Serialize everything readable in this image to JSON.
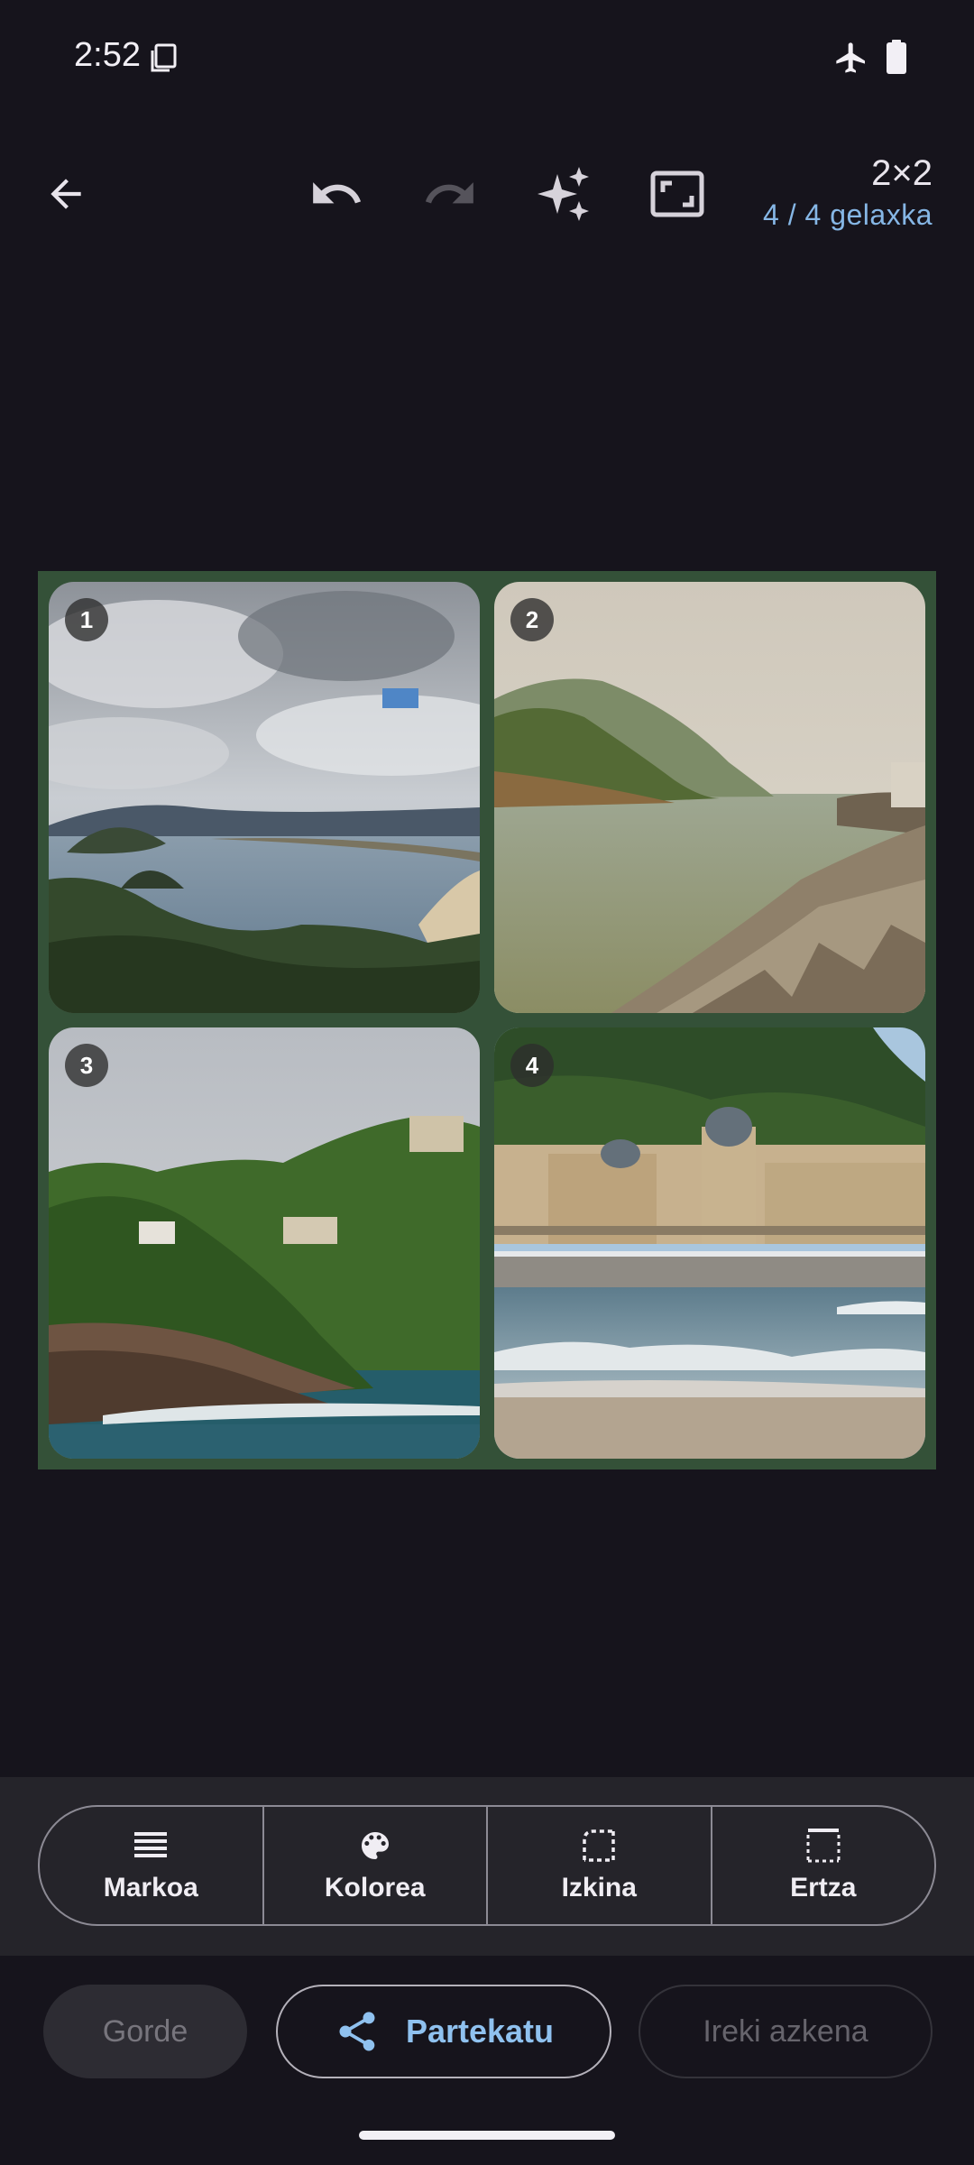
{
  "status": {
    "time": "2:52"
  },
  "toolbar": {
    "grid_size": "2×2",
    "cell_count": "4 / 4 gelaxka"
  },
  "collage": {
    "cells": [
      {
        "number": "1"
      },
      {
        "number": "2"
      },
      {
        "number": "3"
      },
      {
        "number": "4"
      }
    ],
    "border_color": "#345138"
  },
  "tools": [
    {
      "label": "Markoa",
      "icon": "frame-lines-icon"
    },
    {
      "label": "Kolorea",
      "icon": "palette-icon"
    },
    {
      "label": "Izkina",
      "icon": "corner-icon"
    },
    {
      "label": "Ertza",
      "icon": "border-icon"
    }
  ],
  "actions": {
    "save": "Gorde",
    "share": "Partekatu",
    "open_last": "Ireki azkena"
  }
}
